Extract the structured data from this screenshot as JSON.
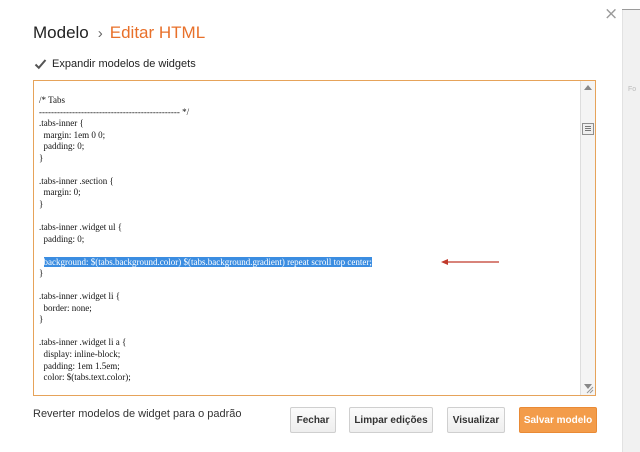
{
  "background": {
    "top_box_text": "",
    "side_label_1": "",
    "side_label_2": "Fo"
  },
  "dialog": {
    "breadcrumb_parent": "Modelo",
    "breadcrumb_separator": "›",
    "breadcrumb_current": "Editar HTML",
    "close_glyph": "×",
    "expand_label": "Expandir modelos de widgets",
    "expand_checked": true,
    "revert_link": "Reverter modelos de widget para o padrão",
    "buttons": {
      "close": "Fechar",
      "clear": "Limpar edições",
      "preview": "Visualizar",
      "save": "Salvar modelo"
    },
    "colors": {
      "accent": "#e8702a",
      "save_button": "#f39c4a",
      "editor_border": "#e6a35a",
      "selection": "#3b8de1",
      "annotation_arrow": "#c0392b"
    }
  },
  "editor": {
    "highlighted_line_index": 14,
    "lines": [
      "/* Tabs",
      "----------------------------------------------- */",
      ".tabs-inner {",
      "  margin: 1em 0 0;",
      "  padding: 0;",
      "}",
      "",
      ".tabs-inner .section {",
      "  margin: 0;",
      "}",
      "",
      ".tabs-inner .widget ul {",
      "  padding: 0;",
      "",
      "  background: $(tabs.background.color) $(tabs.background.gradient) repeat scroll top center;",
      "}",
      "",
      ".tabs-inner .widget li {",
      "  border: none;",
      "}",
      "",
      ".tabs-inner .widget li a {",
      "  display: inline-block;",
      "  padding: 1em 1.5em;",
      "  color: $(tabs.text.color);"
    ]
  }
}
